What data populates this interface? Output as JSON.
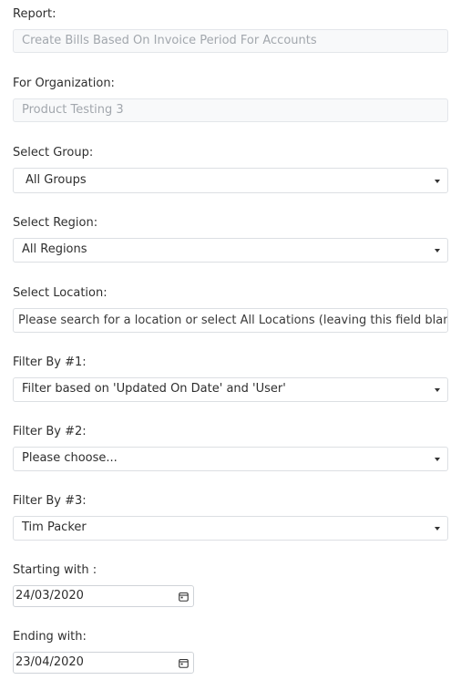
{
  "report": {
    "label": "Report:",
    "value": "Create Bills Based On Invoice Period For Accounts"
  },
  "organization": {
    "label": "For Organization:",
    "value": "Product Testing 3"
  },
  "group": {
    "label": "Select Group:",
    "value": "All Groups"
  },
  "region": {
    "label": "Select Region:",
    "value": "All Regions"
  },
  "location": {
    "label": "Select Location:",
    "placeholder": "Please search for a location or select All Locations (leaving this field blank = "
  },
  "filter1": {
    "label": "Filter By #1:",
    "value": "Filter based on 'Updated On Date' and 'User'"
  },
  "filter2": {
    "label": "Filter By #2:",
    "value": "Please choose..."
  },
  "filter3": {
    "label": "Filter By #3:",
    "value": "Tim Packer"
  },
  "start": {
    "label": "Starting with :",
    "value": "24/03/2020"
  },
  "end": {
    "label": "Ending with:",
    "value": "23/04/2020"
  },
  "icons": {
    "select_caret": "chevron-down-icon",
    "date_picker": "calendar-icon"
  }
}
